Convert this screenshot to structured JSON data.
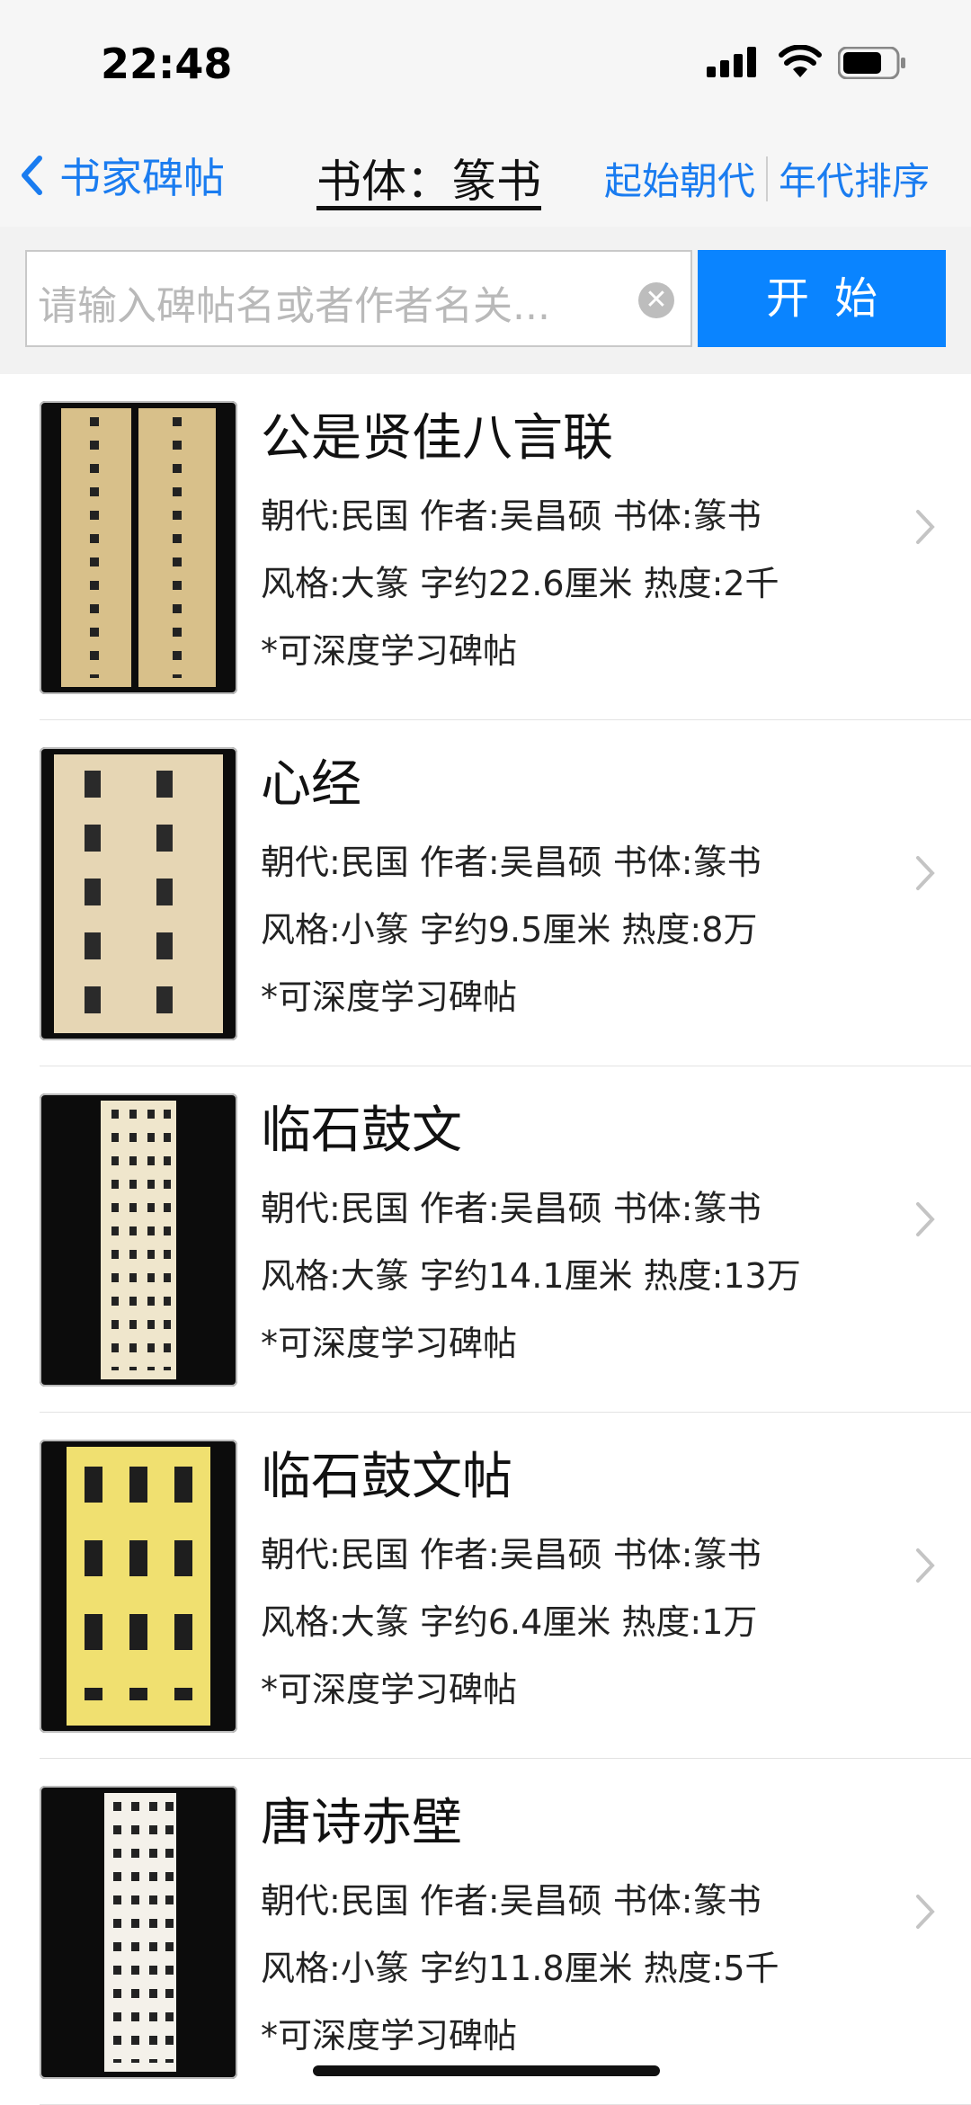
{
  "status": {
    "time": "22:48"
  },
  "nav": {
    "back_label": "书家碑帖",
    "title": "书体：篆书",
    "right_left": "起始朝代",
    "right_right": "年代排序"
  },
  "search": {
    "placeholder": "请输入碑帖名或者作者名关...",
    "button": "开始"
  },
  "items": [
    {
      "name": "公是贤佳八言联",
      "meta": "朝代:民国 作者:吴昌硕 书体:篆书",
      "detail": "风格:大篆 字约22.6厘米 热度:2千",
      "note": "*可深度学习碑帖"
    },
    {
      "name": "心经",
      "meta": "朝代:民国 作者:吴昌硕 书体:篆书",
      "detail": "风格:小篆 字约9.5厘米 热度:8万",
      "note": "*可深度学习碑帖"
    },
    {
      "name": "临石鼓文",
      "meta": "朝代:民国 作者:吴昌硕 书体:篆书",
      "detail": "风格:大篆 字约14.1厘米 热度:13万",
      "note": "*可深度学习碑帖"
    },
    {
      "name": "临石鼓文帖",
      "meta": "朝代:民国 作者:吴昌硕 书体:篆书",
      "detail": "风格:大篆 字约6.4厘米 热度:1万",
      "note": "*可深度学习碑帖"
    },
    {
      "name": "唐诗赤壁",
      "meta": "朝代:民国 作者:吴昌硕 书体:篆书",
      "detail": "风格:小篆 字约11.8厘米 热度:5千",
      "note": "*可深度学习碑帖"
    }
  ],
  "colors": {
    "accent": "#0a84ff",
    "link": "#1a7cf0"
  }
}
